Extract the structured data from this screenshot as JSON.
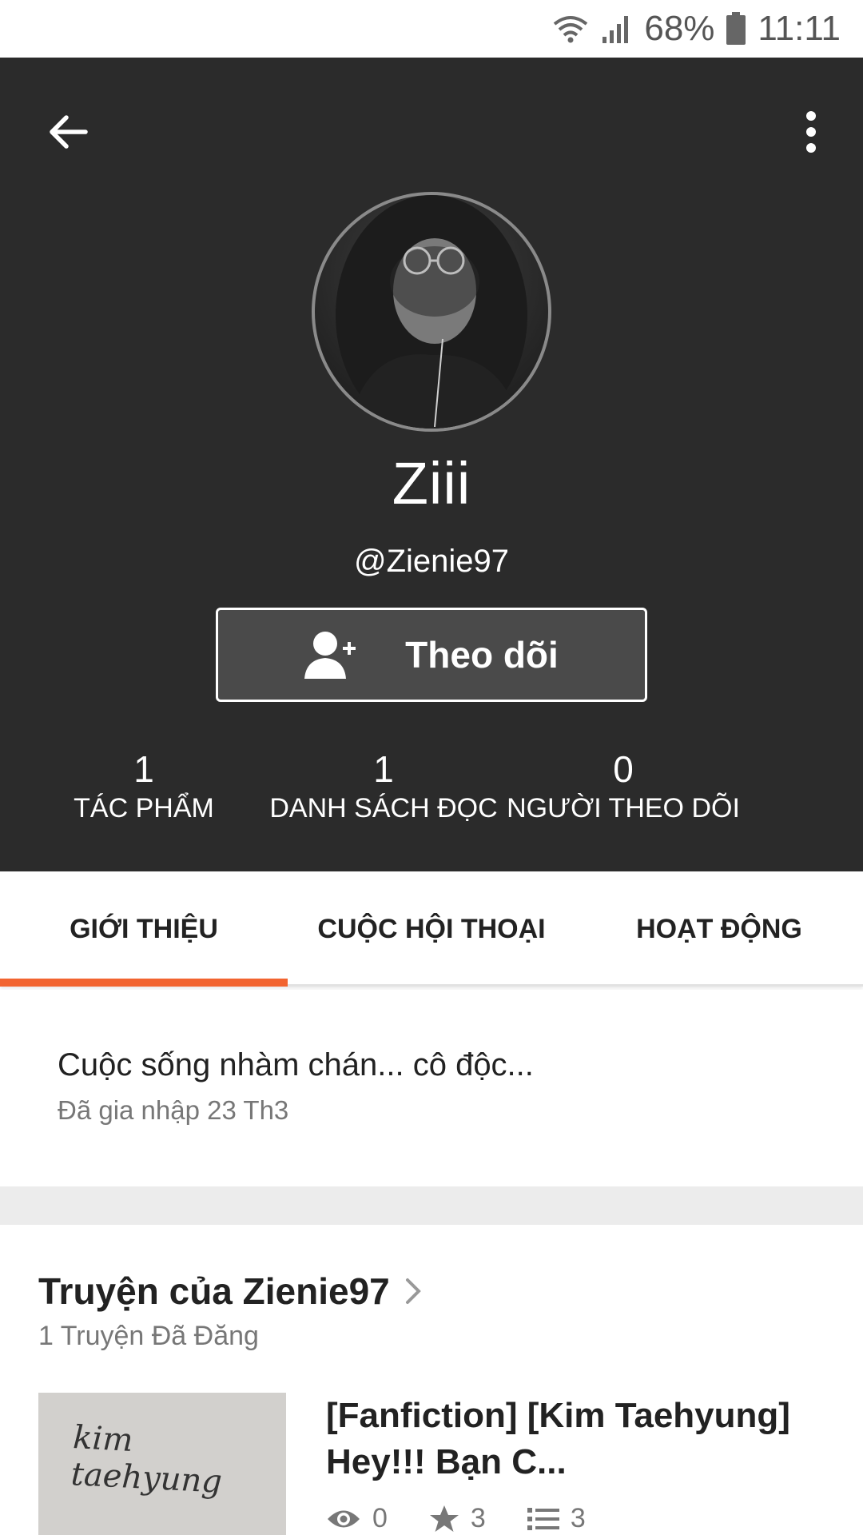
{
  "status_bar": {
    "battery": "68%",
    "time": "11:11"
  },
  "profile": {
    "display_name": "Ziii",
    "username": "@Zienie97",
    "follow_label": "Theo dõi",
    "stats": [
      {
        "value": "1",
        "label": "TÁC PHẨM"
      },
      {
        "value": "1",
        "label": "DANH SÁCH ĐỌC"
      },
      {
        "value": "0",
        "label": "NGƯỜI THEO DÕI"
      }
    ]
  },
  "tabs": [
    {
      "label": "GIỚI THIỆU",
      "active": true
    },
    {
      "label": "CUỘC HỘI THOẠI",
      "active": false
    },
    {
      "label": "HOẠT ĐỘNG",
      "active": false
    }
  ],
  "about": {
    "bio": "Cuộc sống nhàm chán... cô độc...",
    "joined": "Đã gia nhập 23 Th3"
  },
  "stories": {
    "title": "Truyện của Zienie97",
    "count": "1 Truyện Đã Đăng",
    "items": [
      {
        "cover_text": "kim taehyung",
        "title": "[Fanfiction] [Kim Taehyung] Hey!!! Bạn C...",
        "reads": "0",
        "votes": "3",
        "parts": "3"
      }
    ]
  },
  "colors": {
    "header_bg": "#2b2b2b",
    "accent": "#f26430"
  }
}
